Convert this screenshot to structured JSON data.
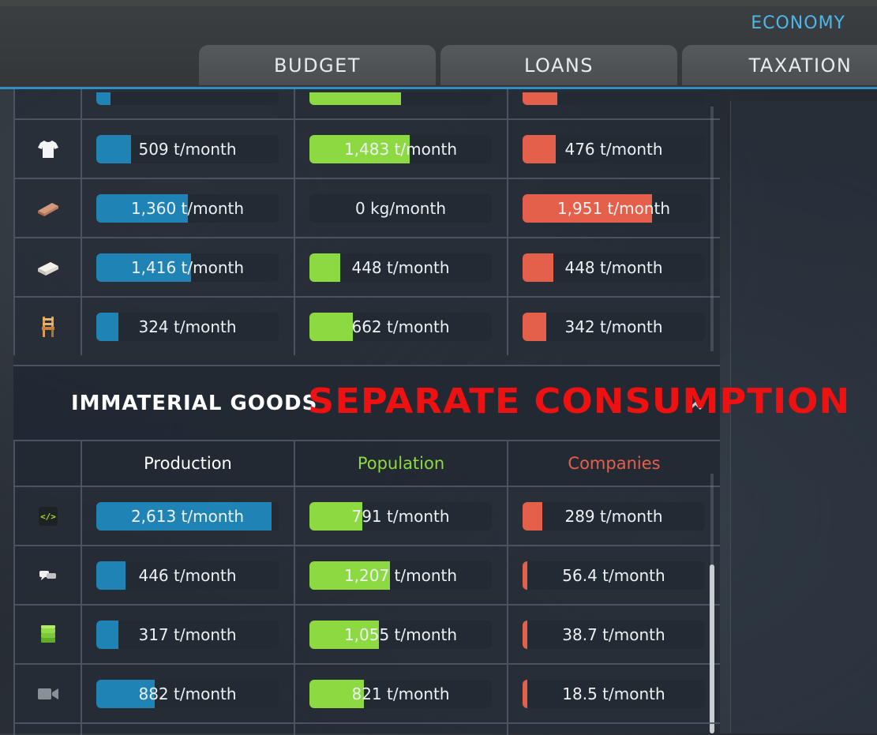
{
  "header": {
    "economy_label": "ECONOMY",
    "tabs": [
      {
        "label": "BUDGET"
      },
      {
        "label": "LOANS"
      },
      {
        "label": "TAXATION"
      }
    ]
  },
  "colors": {
    "accent": "#2f8fc4",
    "production": "#1f84b5",
    "population": "#8cd941",
    "companies": "#e5604a",
    "annotation": "#ee1111"
  },
  "material_rows": [
    {
      "icon": "clothes-icon",
      "production": {
        "label": "509 t/month",
        "fill": 0.19
      },
      "population": {
        "label": "1,483 t/month",
        "fill": 0.55
      },
      "companies": {
        "label": "476 t/month",
        "fill": 0.18
      }
    },
    {
      "icon": "timber-icon",
      "production": {
        "label": "1,360 t/month",
        "fill": 0.5
      },
      "population": {
        "label": "0 kg/month",
        "fill": 0.0
      },
      "companies": {
        "label": "1,951 t/month",
        "fill": 0.71
      }
    },
    {
      "icon": "paper-icon",
      "production": {
        "label": "1,416 t/month",
        "fill": 0.52
      },
      "population": {
        "label": "448 t/month",
        "fill": 0.17
      },
      "companies": {
        "label": "448 t/month",
        "fill": 0.17
      }
    },
    {
      "icon": "furniture-icon",
      "production": {
        "label": "324 t/month",
        "fill": 0.12
      },
      "population": {
        "label": "662 t/month",
        "fill": 0.24
      },
      "companies": {
        "label": "342 t/month",
        "fill": 0.13
      }
    }
  ],
  "immaterial": {
    "title": "IMMATERIAL GOODS",
    "annotation": "SEPARATE CONSUMPTION",
    "columns": {
      "production": "Production",
      "population": "Population",
      "companies": "Companies"
    },
    "rows": [
      {
        "icon": "software-icon",
        "production": {
          "label": "2,613 t/month",
          "fill": 0.96
        },
        "population": {
          "label": "791 t/month",
          "fill": 0.29
        },
        "companies": {
          "label": "289 t/month",
          "fill": 0.11
        }
      },
      {
        "icon": "telecom-icon",
        "production": {
          "label": "446 t/month",
          "fill": 0.16
        },
        "population": {
          "label": "1,207 t/month",
          "fill": 0.44
        },
        "companies": {
          "label": "56.4 t/month",
          "fill": 0.02
        }
      },
      {
        "icon": "financial-icon",
        "production": {
          "label": "317 t/month",
          "fill": 0.12
        },
        "population": {
          "label": "1,055 t/month",
          "fill": 0.38
        },
        "companies": {
          "label": "38.7 t/month",
          "fill": 0.015
        }
      },
      {
        "icon": "media-icon",
        "production": {
          "label": "882 t/month",
          "fill": 0.32
        },
        "population": {
          "label": "821 t/month",
          "fill": 0.3
        },
        "companies": {
          "label": "18.5 t/month",
          "fill": 0.01
        }
      }
    ]
  }
}
